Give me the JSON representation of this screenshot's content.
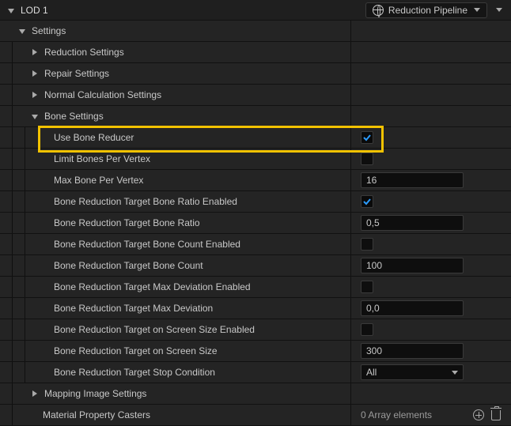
{
  "header": {
    "title": "LOD 1",
    "pipeline_label": "Reduction Pipeline"
  },
  "settings": {
    "label": "Settings",
    "sections": {
      "reduction": "Reduction Settings",
      "repair": "Repair Settings",
      "normal": "Normal Calculation Settings",
      "bone": "Bone Settings",
      "mapping": "Mapping Image Settings",
      "casters": "Material Property Casters"
    },
    "bone_props": {
      "use_reducer": {
        "label": "Use Bone Reducer",
        "checked": true
      },
      "limit_per_vertex": {
        "label": "Limit Bones Per Vertex",
        "checked": false
      },
      "max_per_vertex": {
        "label": "Max Bone Per Vertex",
        "value": "16"
      },
      "ratio_enabled": {
        "label": "Bone Reduction Target Bone Ratio Enabled",
        "checked": true
      },
      "ratio": {
        "label": "Bone Reduction Target Bone Ratio",
        "value": "0,5"
      },
      "count_enabled": {
        "label": "Bone Reduction Target Bone Count Enabled",
        "checked": false
      },
      "count": {
        "label": "Bone Reduction Target Bone Count",
        "value": "100"
      },
      "maxdev_enabled": {
        "label": "Bone Reduction Target Max Deviation Enabled",
        "checked": false
      },
      "maxdev": {
        "label": "Bone Reduction Target Max Deviation",
        "value": "0,0"
      },
      "onscreen_enabled": {
        "label": "Bone Reduction Target on Screen Size Enabled",
        "checked": false
      },
      "onscreen": {
        "label": "Bone Reduction Target on Screen Size",
        "value": "300"
      },
      "stop": {
        "label": "Bone Reduction Target Stop Condition",
        "value": "All"
      }
    },
    "casters_count": "0 Array elements"
  }
}
